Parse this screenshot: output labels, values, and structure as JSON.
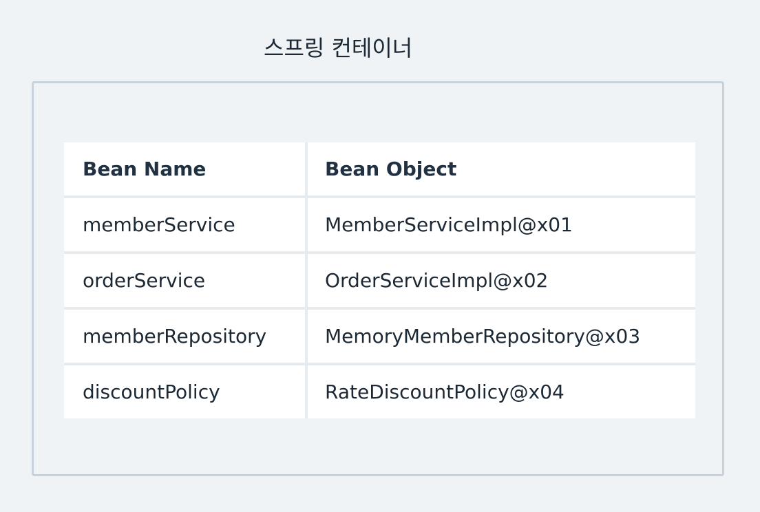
{
  "container": {
    "title": "스프링 컨테이너"
  },
  "table": {
    "headers": [
      "Bean Name",
      "Bean Object"
    ],
    "rows": [
      [
        "memberService",
        "MemberServiceImpl@x01"
      ],
      [
        "orderService",
        "OrderServiceImpl@x02"
      ],
      [
        "memberRepository",
        "MemoryMemberRepository@x03"
      ],
      [
        "discountPolicy",
        "RateDiscountPolicy@x04"
      ]
    ]
  },
  "colors": {
    "background": "#eff3f6",
    "container_border": "#c7d2dc",
    "cell_background": "#ffffff",
    "text": "#1c2833"
  }
}
